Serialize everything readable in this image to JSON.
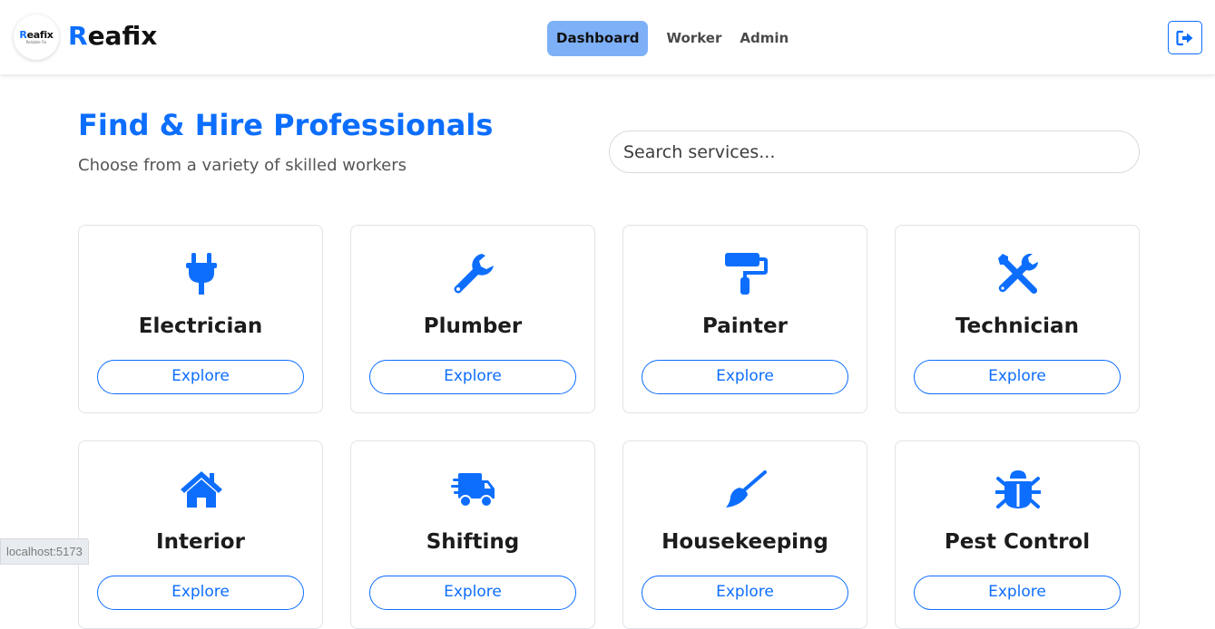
{
  "brand": {
    "logo_small": "Reafix",
    "logo_small_first": "R",
    "logo_small_rest": "eafix",
    "logo_tagline": "Reliable Fix",
    "name_first": "R",
    "name_rest": "eafix"
  },
  "nav": {
    "items": [
      {
        "label": "Dashboard",
        "active": true
      },
      {
        "label": "Worker",
        "active": false
      },
      {
        "label": "Admin",
        "active": false
      }
    ],
    "logout_icon": "sign-out-icon"
  },
  "hero": {
    "title": "Find & Hire Professionals",
    "subtitle": "Choose from a variety of skilled workers"
  },
  "search": {
    "placeholder": "Search services...",
    "value": ""
  },
  "services": [
    {
      "name": "Electrician",
      "icon": "plug-icon",
      "button": "Explore"
    },
    {
      "name": "Plumber",
      "icon": "wrench-icon",
      "button": "Explore"
    },
    {
      "name": "Painter",
      "icon": "paint-roller-icon",
      "button": "Explore"
    },
    {
      "name": "Technician",
      "icon": "tools-icon",
      "button": "Explore"
    },
    {
      "name": "Interior",
      "icon": "home-icon",
      "button": "Explore"
    },
    {
      "name": "Shifting",
      "icon": "truck-fast-icon",
      "button": "Explore"
    },
    {
      "name": "Housekeeping",
      "icon": "broom-icon",
      "button": "Explore"
    },
    {
      "name": "Pest Control",
      "icon": "bug-icon",
      "button": "Explore"
    }
  ],
  "status_bar": {
    "url": "localhost:5173"
  },
  "colors": {
    "accent": "#0d6efd",
    "active_nav_bg": "#7db0f7"
  }
}
